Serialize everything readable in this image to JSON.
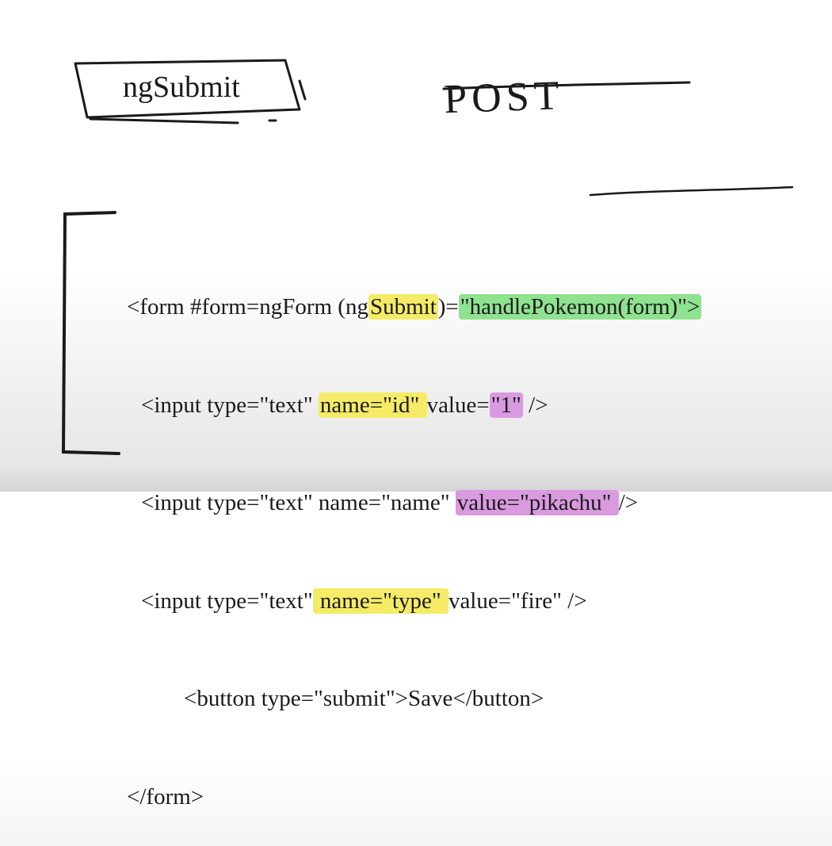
{
  "title": {
    "label": "ngSubmit"
  },
  "post_label": "POST",
  "code": {
    "line1": {
      "open": "<form #form=ngForm (ng",
      "submit_word": "Submit",
      "paren_eq": ")=",
      "handler": "\"handlePokemon(form)\">"
    },
    "line2": {
      "prefix": "<input type=\"text\" ",
      "name_attr": "name=\"id\" ",
      "value_word": "value=",
      "value_val": "\"1\"",
      "suffix": " />"
    },
    "line3": {
      "prefix": "<input type=\"text\" name=\"name\" ",
      "value_attr": "value=\"pikachu\" ",
      "suffix": "/>"
    },
    "line4": {
      "prefix": "<input type=\"text\"",
      "name_attr": " name=\"type\" ",
      "rest": "value=\"fire\" />"
    },
    "line5": {
      "prefix": "<button type=\"",
      "submit": "submit",
      "suffix": "\">Save</button>"
    },
    "line6": "</form>"
  },
  "colors": {
    "ink": "#1a1a1a",
    "red": "#c01818",
    "green": "#8fe28f",
    "yellow": "#f5eb66",
    "purple": "#d99ae0"
  }
}
